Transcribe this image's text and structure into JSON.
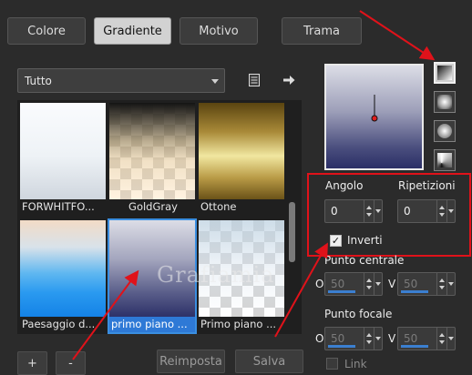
{
  "tabs": [
    {
      "label": "Colore"
    },
    {
      "label": "Gradiente"
    },
    {
      "label": "Motivo"
    },
    {
      "label": "Trama"
    }
  ],
  "category": {
    "selected": "Tutto"
  },
  "swatches": [
    {
      "label": "FORWHITFO..."
    },
    {
      "label": "GoldGray"
    },
    {
      "label": "Ottone"
    },
    {
      "label": "Paesaggio d..."
    },
    {
      "label": "primo piano ..."
    },
    {
      "label": "Primo piano ..."
    }
  ],
  "bottom_buttons": {
    "add": "+",
    "remove": "-",
    "reset": "Reimposta",
    "save": "Salva"
  },
  "angle": {
    "label": "Angolo",
    "value": "0"
  },
  "repeats": {
    "label": "Ripetizioni",
    "value": "0"
  },
  "invert": {
    "label": "Inverti",
    "checked": true
  },
  "center_point": {
    "label": "Punto centrale",
    "h_label": "O",
    "h_value": "50",
    "v_label": "V",
    "v_value": "50"
  },
  "focal_point": {
    "label": "Punto focale",
    "h_label": "O",
    "h_value": "50",
    "v_label": "V",
    "v_value": "50"
  },
  "link": {
    "label": "Link",
    "checked": false
  },
  "watermark": "Grafiamia",
  "colors": {
    "accent": "#3a8ee0",
    "highlight_red": "#e0121a",
    "background": "#2b2b2b"
  }
}
